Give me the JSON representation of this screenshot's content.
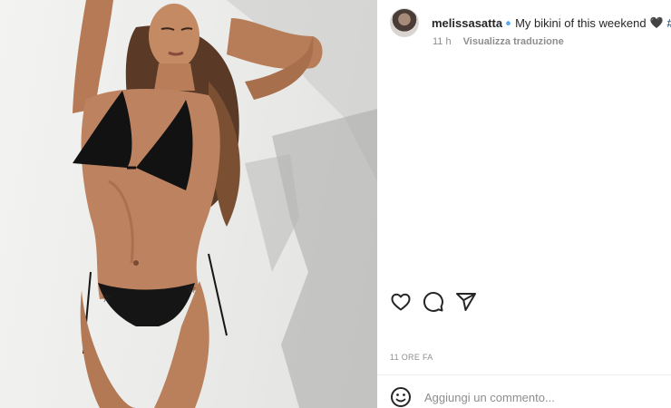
{
  "post": {
    "username": "melissasatta",
    "caption": "My bikini of this weekend",
    "caption_emoji": "🖤",
    "hashtag_fragment": "#p",
    "time_ago": "11 h",
    "translate_link": "Visualizza traduzione",
    "date_label": "11 ORE FA"
  },
  "comment": {
    "placeholder": "Aggiungi un commento..."
  },
  "icons": {
    "verified": "verified-badge-icon",
    "like": "heart-outline-icon",
    "comment": "speech-bubble-icon",
    "share": "paper-plane-icon",
    "emoji": "smiley-icon"
  },
  "colors": {
    "verified_blue": "#3897f0",
    "hashtag_blue": "#00376b",
    "muted_text": "#8e8e8e"
  }
}
